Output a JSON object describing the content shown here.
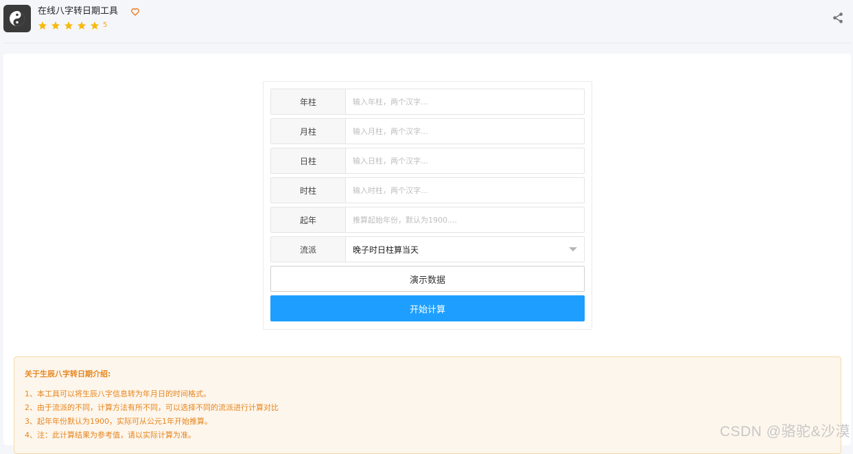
{
  "header": {
    "app_title": "在线八字转日期工具",
    "rating_value": "5",
    "stars": 5,
    "logo_icon": "yin-yang-icon",
    "favorite_icon": "heart-outline-icon",
    "share_icon": "share-icon",
    "accent_color": "#f5a623"
  },
  "form": {
    "rows": [
      {
        "label": "年柱",
        "placeholder": "输入年柱，两个汉字..."
      },
      {
        "label": "月柱",
        "placeholder": "输入月柱，两个汉字..."
      },
      {
        "label": "日柱",
        "placeholder": "输入日柱，两个汉字..."
      },
      {
        "label": "时柱",
        "placeholder": "输入时柱，两个汉字..."
      },
      {
        "label": "起年",
        "placeholder": "推算起始年份，默认为1900...."
      }
    ],
    "school": {
      "label": "流派",
      "selected": "晚子时日柱算当天"
    },
    "demo_button": "演示数据",
    "start_button": "开始计算",
    "primary_color": "#1e9fff"
  },
  "info": {
    "title": "关于生辰八字转日期介绍:",
    "items": [
      "1、本工具可以将生辰八字信息转为年月日的时间格式。",
      "2、由于流派的不同，计算方法有所不同，可以选择不同的流派进行计算对比",
      "3、起年年份默认为1900，实际可从公元1年开始推算。",
      "4、注：此计算结果为参考值，请以实际计算为准。"
    ],
    "text_color": "#e6851e"
  },
  "watermark": "CSDN @骆驼&沙漠"
}
